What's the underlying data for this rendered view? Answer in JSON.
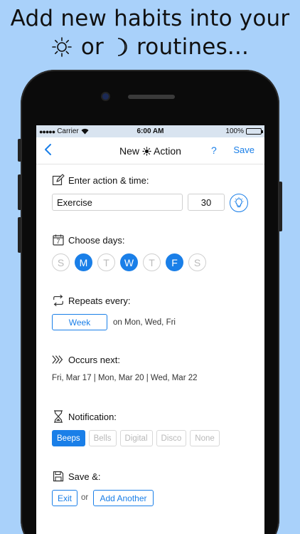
{
  "headline": {
    "line1": "Add new habits into your",
    "line2_or": "or",
    "line2_end": "routines...",
    "sun_icon": "sun-icon",
    "moon_icon": "moon-icon"
  },
  "status_bar": {
    "carrier": "Carrier",
    "signal_dots": "●●●●●",
    "time": "6:00 AM",
    "battery": "100%",
    "battery_level": 1.0
  },
  "nav": {
    "back": "‹",
    "title_pre": "New",
    "title_post": "Action",
    "help": "?",
    "save": "Save"
  },
  "action": {
    "header": "Enter action & time:",
    "name_value": "Exercise",
    "time_value": "30"
  },
  "days": {
    "header": "Choose days:",
    "calendar_number": "7",
    "items": [
      {
        "label": "S",
        "selected": false
      },
      {
        "label": "M",
        "selected": true
      },
      {
        "label": "T",
        "selected": false
      },
      {
        "label": "W",
        "selected": true
      },
      {
        "label": "T",
        "selected": false
      },
      {
        "label": "F",
        "selected": true
      },
      {
        "label": "S",
        "selected": false
      }
    ]
  },
  "repeat": {
    "header": "Repeats every:",
    "period": "Week",
    "summary": "on Mon, Wed, Fri"
  },
  "occurs": {
    "header": "Occurs next:",
    "dates": "Fri, Mar 17 | Mon, Mar 20 | Wed, Mar 22"
  },
  "notification": {
    "header": "Notification:",
    "options": [
      {
        "label": "Beeps",
        "selected": true
      },
      {
        "label": "Bells",
        "selected": false
      },
      {
        "label": "Digital",
        "selected": false
      },
      {
        "label": "Disco",
        "selected": false
      },
      {
        "label": "None",
        "selected": false
      }
    ]
  },
  "save_section": {
    "header": "Save &:",
    "exit": "Exit",
    "or": "or",
    "add_another": "Add Another"
  },
  "colors": {
    "accent": "#1a7fe8",
    "background": "#a9d1fa"
  }
}
